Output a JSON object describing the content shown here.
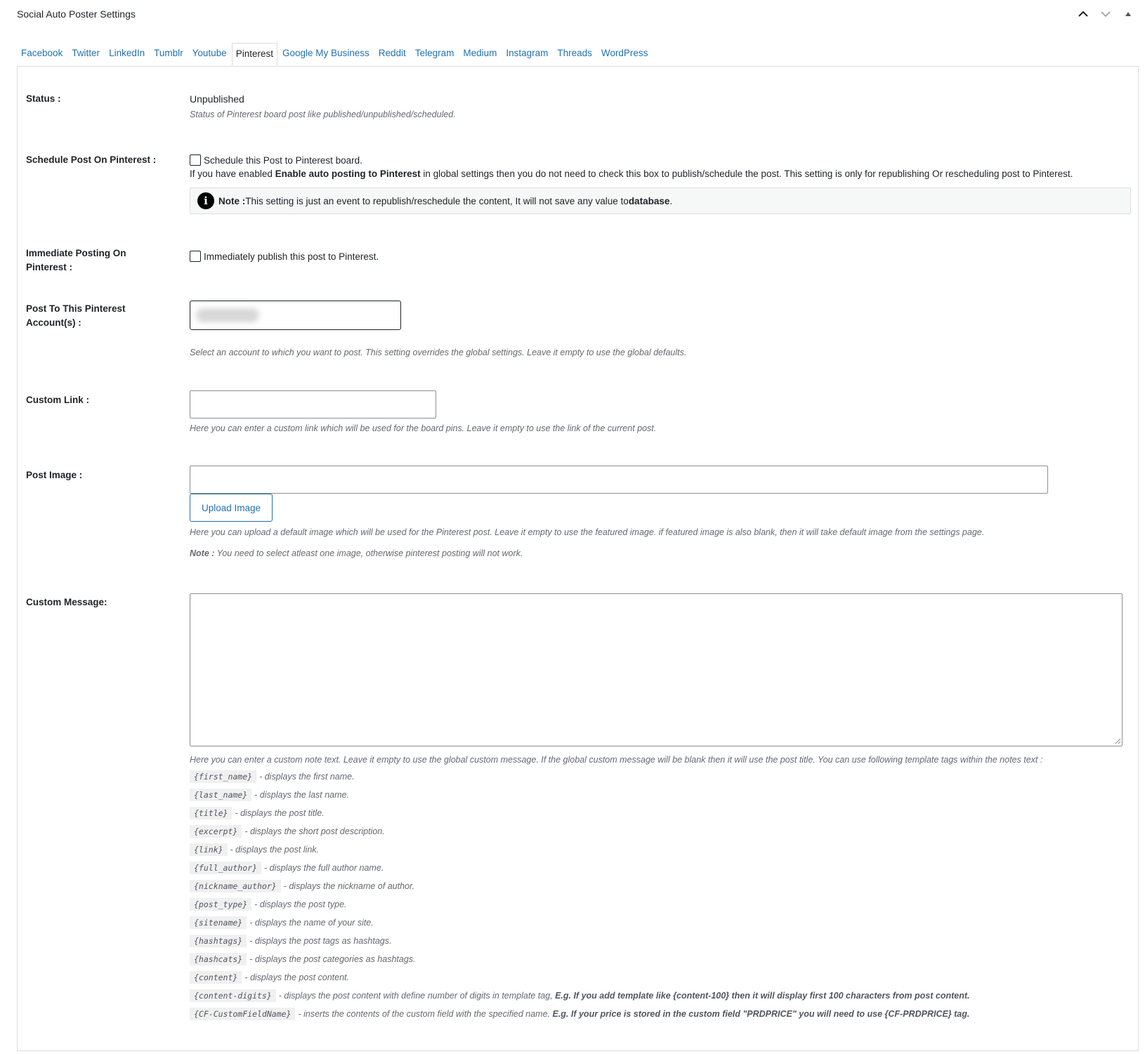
{
  "panel": {
    "title": "Social Auto Poster Settings"
  },
  "tabs": [
    {
      "label": "Facebook"
    },
    {
      "label": "Twitter"
    },
    {
      "label": "LinkedIn"
    },
    {
      "label": "Tumblr"
    },
    {
      "label": "Youtube"
    },
    {
      "label": "Pinterest",
      "active": true
    },
    {
      "label": "Google My Business"
    },
    {
      "label": "Reddit"
    },
    {
      "label": "Telegram"
    },
    {
      "label": "Medium"
    },
    {
      "label": "Instagram"
    },
    {
      "label": "Threads"
    },
    {
      "label": "WordPress"
    }
  ],
  "status": {
    "label": "Status :",
    "value": "Unpublished",
    "desc": "Status of Pinterest board post like published/unpublished/scheduled."
  },
  "schedule": {
    "label": "Schedule Post On Pinterest :",
    "checkbox_label": "Schedule this Post to Pinterest board.",
    "help_prefix": "If you have enabled ",
    "help_bold": "Enable auto posting to Pinterest",
    "help_suffix": " in global settings then you do not need to check this box to publish/schedule the post. This setting is only for republishing Or rescheduling post to Pinterest.",
    "note_bold": "Note :",
    "note_text": " This setting is just an event to republish/reschedule the content, It will not save any value to ",
    "note_bold_end": "database",
    "note_end": "."
  },
  "immediate": {
    "label": "Immediate Posting On Pinterest :",
    "checkbox_label": "Immediately publish this post to Pinterest."
  },
  "accounts": {
    "label": "Post To This Pinterest Account(s) :",
    "desc": "Select an account to which you want to post. This setting overrides the global settings. Leave it empty to use the global defaults."
  },
  "custom_link": {
    "label": "Custom Link :",
    "value": "",
    "desc": "Here you can enter a custom link which will be used for the board pins. Leave it empty to use the link of the current post."
  },
  "post_image": {
    "label": "Post Image :",
    "value": "",
    "button": "Upload Image",
    "desc": "Here you can upload a default image which will be used for the Pinterest post. Leave it empty to use the featured image. if featured image is also blank, then it will take default image from the settings page.",
    "note_bold": "Note :",
    "note_text": " You need to select atleast one image, otherwise pinterest posting will not work."
  },
  "custom_message": {
    "label": "Custom Message:",
    "value": "",
    "desc": "Here you can enter a custom note text. Leave it empty to use the global custom message. If the global custom message will be blank then it will use the post title. You can use following template tags within the notes text :",
    "tags": [
      {
        "code": "{first_name}",
        "desc": "- displays the first name.",
        "extra": ""
      },
      {
        "code": "{last_name}",
        "desc": "- displays the last name.",
        "extra": ""
      },
      {
        "code": "{title}",
        "desc": "- displays the post title.",
        "extra": ""
      },
      {
        "code": "{excerpt}",
        "desc": "- displays the short post description.",
        "extra": ""
      },
      {
        "code": "{link}",
        "desc": "- displays the post link.",
        "extra": ""
      },
      {
        "code": "{full_author}",
        "desc": "- displays the full author name.",
        "extra": ""
      },
      {
        "code": "{nickname_author}",
        "desc": "- displays the nickname of author.",
        "extra": ""
      },
      {
        "code": "{post_type}",
        "desc": "- displays the post type.",
        "extra": ""
      },
      {
        "code": "{sitename}",
        "desc": "- displays the name of your site.",
        "extra": ""
      },
      {
        "code": "{hashtags}",
        "desc": "- displays the post tags as hashtags.",
        "extra": ""
      },
      {
        "code": "{hashcats}",
        "desc": "- displays the post categories as hashtags.",
        "extra": ""
      },
      {
        "code": "{content}",
        "desc": "- displays the post content.",
        "extra": ""
      },
      {
        "code": "{content-digits}",
        "desc": "- displays the post content with define number of digits in template tag, ",
        "extra": "E.g. If you add template like {content-100} then it will display first 100 characters from post content."
      },
      {
        "code": "{CF-CustomFieldName}",
        "desc": "- inserts the contents of the custom field with the specified name. ",
        "extra": "E.g. If your price is stored in the custom field \"PRDPRICE\" you will need to use {CF-PRDPRICE} tag."
      }
    ]
  },
  "icons": {
    "collapse": "chevron-up-icon",
    "expand": "chevron-down-icon",
    "toggle": "triangle-up-icon",
    "info": "info-icon"
  }
}
